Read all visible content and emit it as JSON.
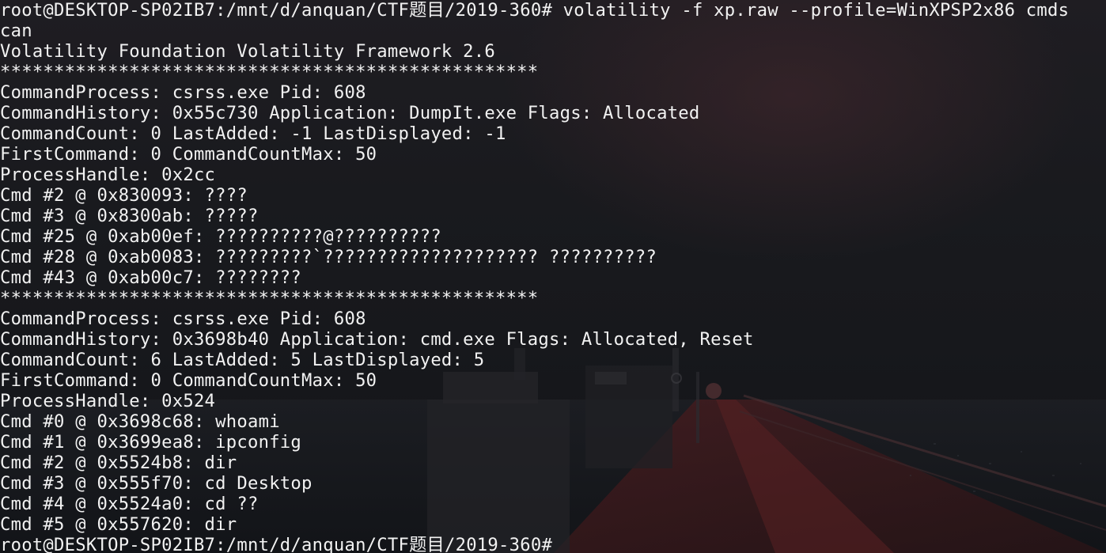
{
  "terminal": {
    "lines": [
      "root@DESKTOP-SP02IB7:/mnt/d/anquan/CTF题目/2019-360# volatility -f xp.raw --profile=WinXPSP2x86 cmds",
      "can",
      "Volatility Foundation Volatility Framework 2.6",
      "**************************************************",
      "CommandProcess: csrss.exe Pid: 608",
      "CommandHistory: 0x55c730 Application: DumpIt.exe Flags: Allocated",
      "CommandCount: 0 LastAdded: -1 LastDisplayed: -1",
      "FirstCommand: 0 CommandCountMax: 50",
      "ProcessHandle: 0x2cc",
      "Cmd #2 @ 0x830093: ????",
      "Cmd #3 @ 0x8300ab: ?????",
      "Cmd #25 @ 0xab00ef: ??????????@??????????",
      "Cmd #28 @ 0xab0083: ?????????`???????????????????? ??????????",
      "Cmd #43 @ 0xab00c7: ????????",
      "**************************************************",
      "CommandProcess: csrss.exe Pid: 608",
      "CommandHistory: 0x3698b40 Application: cmd.exe Flags: Allocated, Reset",
      "CommandCount: 6 LastAdded: 5 LastDisplayed: 5",
      "FirstCommand: 0 CommandCountMax: 50",
      "ProcessHandle: 0x524",
      "Cmd #0 @ 0x3698c68: whoami",
      "Cmd #1 @ 0x3699ea8: ipconfig",
      "Cmd #2 @ 0x5524b8: dir",
      "Cmd #3 @ 0x555f70: cd Desktop",
      "Cmd #4 @ 0x5524a0: cd ??",
      "Cmd #5 @ 0x557620: dir",
      "root@DESKTOP-SP02IB7:/mnt/d/anquan/CTF题目/2019-360#"
    ]
  },
  "colors": {
    "text": "#f2f2f2",
    "background": "#17181c",
    "background_accent": "#8a2a2a"
  }
}
